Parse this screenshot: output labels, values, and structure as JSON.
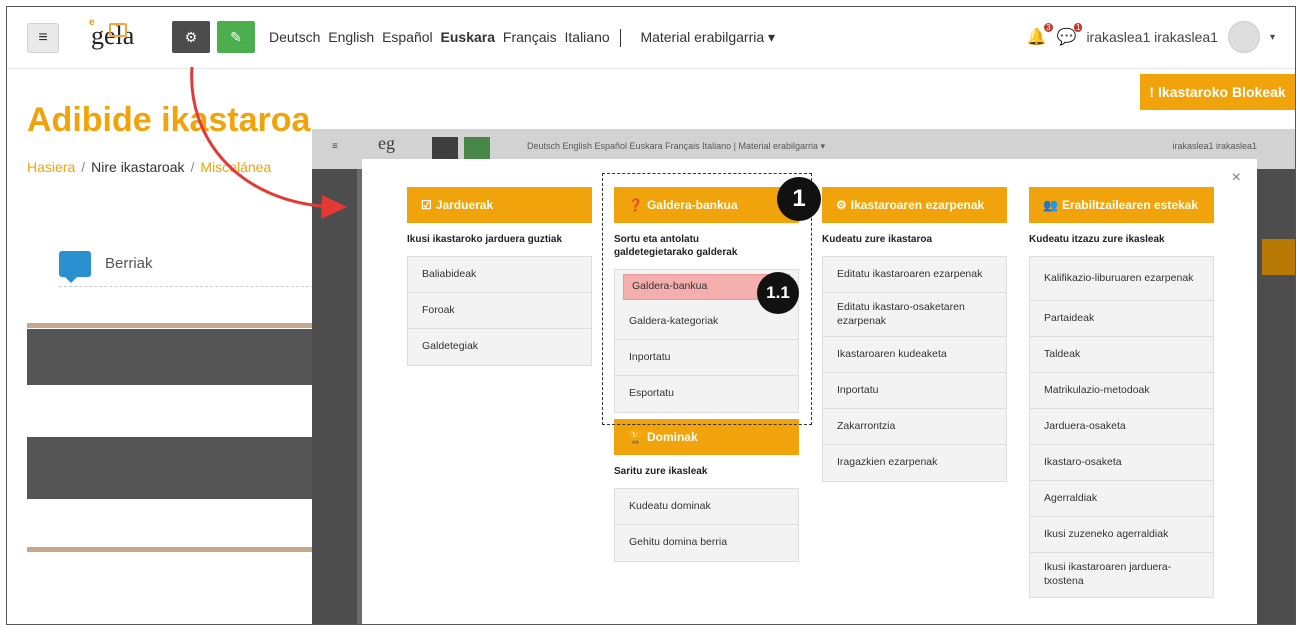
{
  "navbar": {
    "languages": [
      {
        "label": "Deutsch",
        "bold": false
      },
      {
        "label": "English",
        "bold": false
      },
      {
        "label": "Español",
        "bold": false
      },
      {
        "label": "Euskara",
        "bold": true
      },
      {
        "label": "Français",
        "bold": false
      },
      {
        "label": "Italiano",
        "bold": false
      }
    ],
    "material": "Material erabilgarria ▾",
    "user": "irakaslea1 irakaslea1",
    "notif_count": "3",
    "msg_count": "1"
  },
  "blocks_button": "Ikastaroko Blokeak",
  "page": {
    "title": "Adibide ikastaroa",
    "breadcrumb": [
      "Hasiera",
      "Nire ikastaroak",
      "Miscelánea"
    ],
    "berriak": "Berriak"
  },
  "overlay": {
    "nav_text": "Deutsch  English  Español  Euskara  Français  Italiano  |  Material erabilgarria ▾",
    "user": "irakaslea1 irakaslea1"
  },
  "modal": {
    "columns": [
      {
        "title": "Jarduerak",
        "desc": "Ikusi ikastaroko jarduera guztiak",
        "items": [
          "Baliabideak",
          "Foroak",
          "Galdetegiak"
        ]
      },
      {
        "title": "Galdera-bankua",
        "desc": "Sortu eta antolatu galdetegietarako galderak",
        "items": [
          "Galdera-bankua",
          "Galdera-kategoriak",
          "Inportatu",
          "Esportatu"
        ]
      },
      {
        "title": "Ikastaroaren ezarpenak",
        "desc": "Kudeatu zure ikastaroa",
        "items": [
          "Editatu ikastaroaren ezarpenak",
          "Editatu ikastaro-osaketaren ezarpenak",
          "Ikastaroaren kudeaketa",
          "Inportatu",
          "Zakarrontzia",
          "Iragazkien ezarpenak"
        ]
      },
      {
        "title": "Erabiltzailearen estekak",
        "desc": "Kudeatu itzazu zure ikasleak",
        "items": [
          "Kalifikazio-liburuaren ezarpenak",
          "Partaideak",
          "Taldeak",
          "Matrikulazio-metodoak",
          "Jarduera-osaketa",
          "Ikastaro-osaketa",
          "Agerraldiak",
          "Ikusi zuzeneko agerraldiak",
          "Ikusi ikastaroaren jarduera-txostena"
        ]
      }
    ],
    "dominak": {
      "title": "Dominak",
      "desc": "Saritu zure ikasleak",
      "items": [
        "Kudeatu dominak",
        "Gehitu domina berria"
      ]
    },
    "markers": [
      "1",
      "1.1"
    ]
  }
}
